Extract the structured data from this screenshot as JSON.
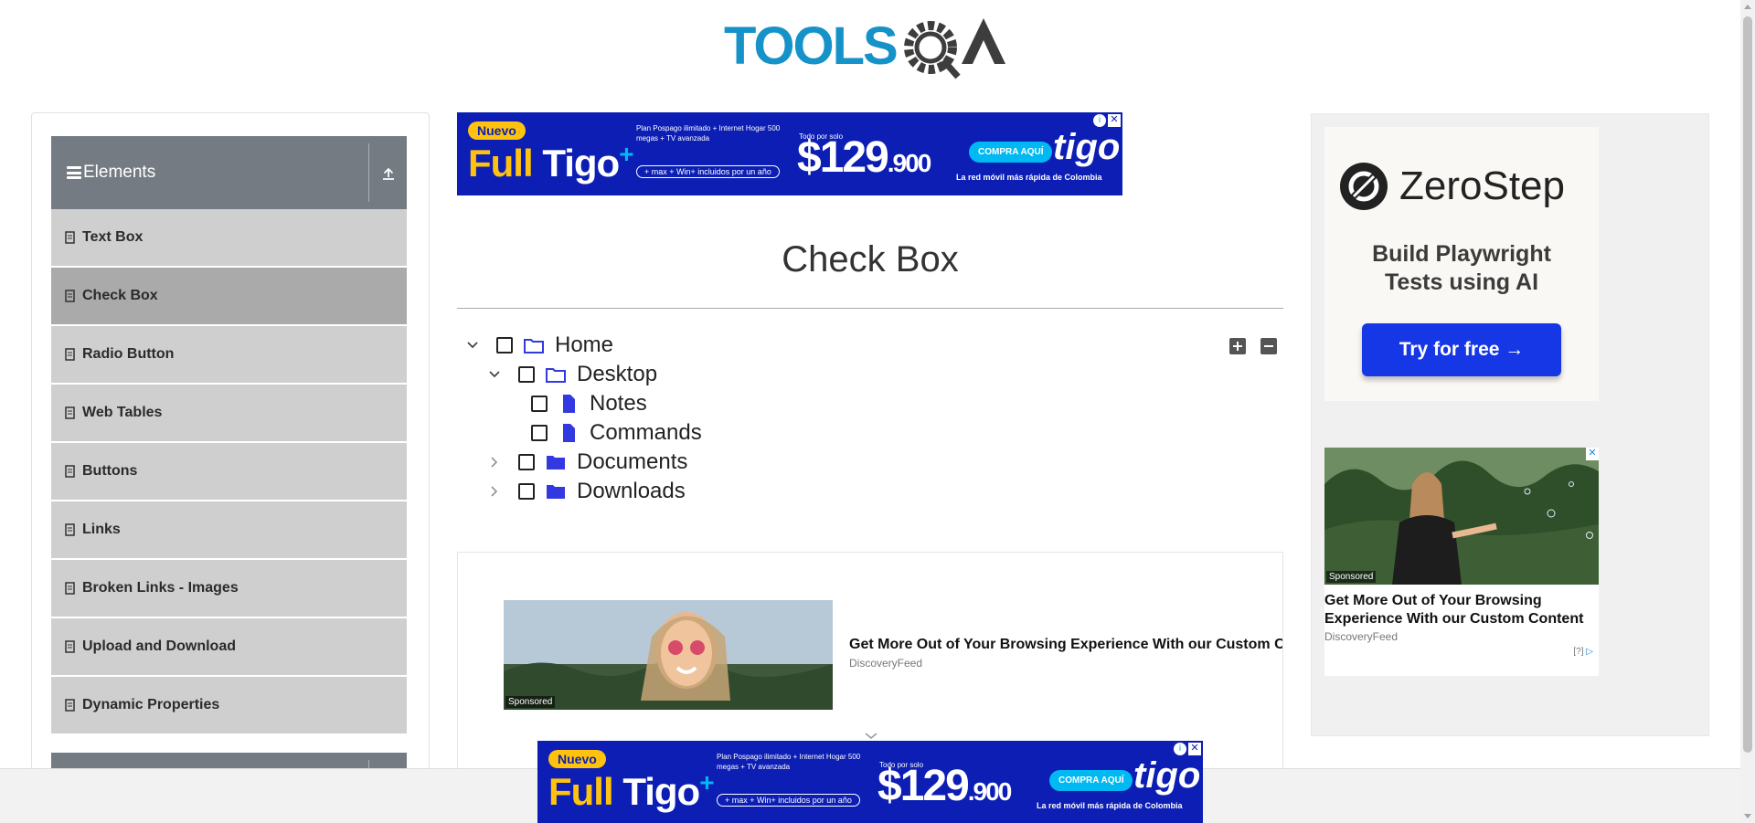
{
  "header": {
    "logo_text": "TOOLSQA",
    "logo_icon": "gear-magnifier-icon"
  },
  "sidebar": {
    "group_title": "Elements",
    "items": [
      {
        "label": "Text Box",
        "active": false
      },
      {
        "label": "Check Box",
        "active": true
      },
      {
        "label": "Radio Button",
        "active": false
      },
      {
        "label": "Web Tables",
        "active": false
      },
      {
        "label": "Buttons",
        "active": false
      },
      {
        "label": "Links",
        "active": false
      },
      {
        "label": "Broken Links - Images",
        "active": false
      },
      {
        "label": "Upload and Download",
        "active": false
      },
      {
        "label": "Dynamic Properties",
        "active": false
      }
    ]
  },
  "ad_tigo": {
    "badge": "Nuevo",
    "headline_a": "Full ",
    "headline_b": "Tigo",
    "plus": "+",
    "features": "Plan Pospago ilimitado + Internet Hogar 500 megas + TV avanzada",
    "extras": "+ max + Win+ incluidos por un año",
    "price_prefix": "Todo por solo",
    "price": "$129",
    "price_cents": ".900",
    "cta": "COMPRA AQUÍ",
    "brand": "tigo",
    "tagline": "La red móvil más rápida de Colombia",
    "colors": {
      "bg": "#0c1eb4",
      "accent": "#ffc20e",
      "cta": "#00b9f2"
    }
  },
  "main": {
    "title": "Check Box",
    "tree": {
      "home": "Home",
      "desktop": "Desktop",
      "notes": "Notes",
      "commands": "Commands",
      "documents": "Documents",
      "downloads": "Downloads"
    }
  },
  "feed_ad": {
    "sponsored": "Sponsored",
    "title": "Get More Out of Your Browsing Experience With our Custom Content",
    "source": "DiscoveryFeed"
  },
  "right_ads": {
    "zerostep": {
      "brand": "ZeroStep",
      "copy_line1": "Build Playwright",
      "copy_line2": "Tests using AI",
      "cta": "Try for free →",
      "color_cta": "#1537e6"
    },
    "discoveryfeed": {
      "sponsored": "Sponsored",
      "title": "Get More Out of Your Browsing Experience With our Custom Content",
      "source": "DiscoveryFeed",
      "adchoice": "[?]"
    }
  }
}
